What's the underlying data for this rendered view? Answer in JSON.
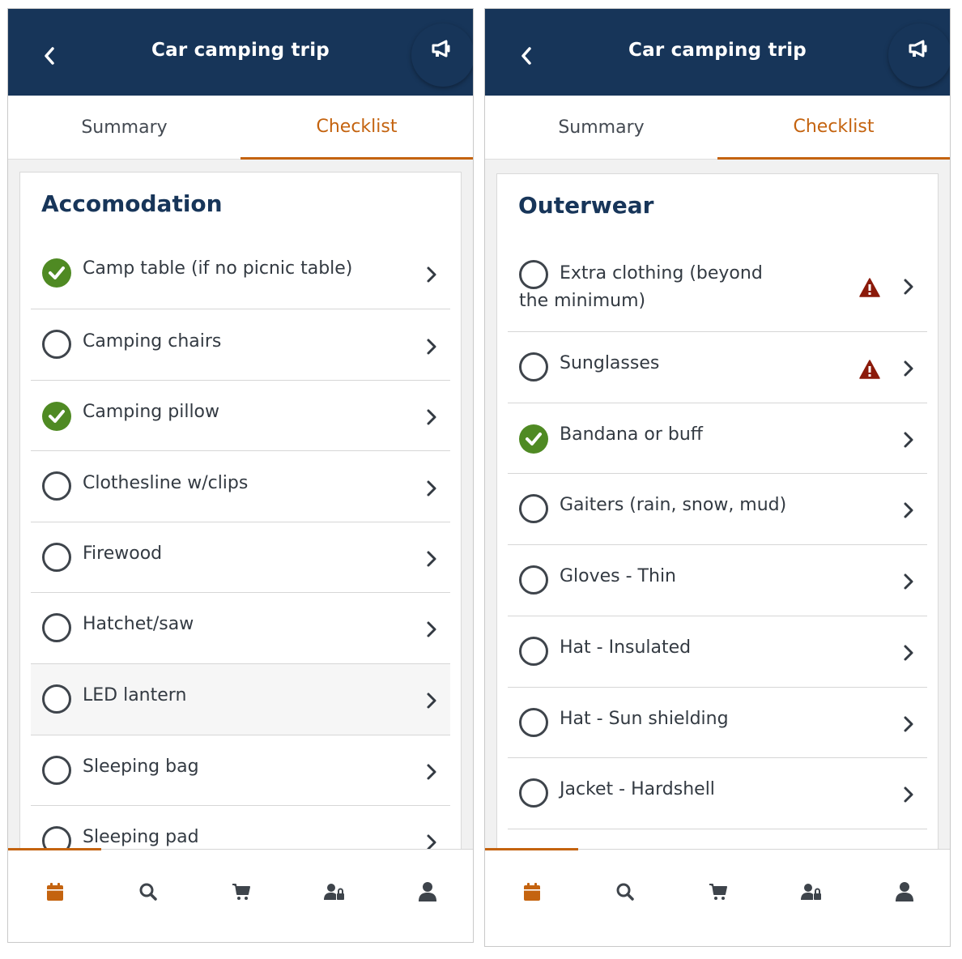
{
  "colors": {
    "header_bg": "#173559",
    "accent": "#c4630f",
    "check_green": "#4f8a23",
    "warning_red": "#8b1a0a",
    "icon_gray": "#3e444b"
  },
  "screens": [
    {
      "header": {
        "title": "Car camping trip",
        "back_icon": "chevron-left-icon",
        "action_icon": "megaphone-icon"
      },
      "tabs": [
        {
          "label": "Summary",
          "active": false
        },
        {
          "label": "Checklist",
          "active": true
        }
      ],
      "section_title": "Accomodation",
      "items": [
        {
          "label": "Camp table (if no picnic table)",
          "checked": true,
          "warning": false
        },
        {
          "label": "Camping chairs",
          "checked": false,
          "warning": false
        },
        {
          "label": "Camping pillow",
          "checked": true,
          "warning": false
        },
        {
          "label": "Clothesline w/clips",
          "checked": false,
          "warning": false
        },
        {
          "label": "Firewood",
          "checked": false,
          "warning": false
        },
        {
          "label": "Hatchet/saw",
          "checked": false,
          "warning": false
        },
        {
          "label": "LED lantern",
          "checked": false,
          "warning": false,
          "highlighted": true
        },
        {
          "label": "Sleeping bag",
          "checked": false,
          "warning": false
        },
        {
          "label": "Sleeping pad",
          "checked": false,
          "warning": false
        }
      ],
      "bottom_nav": [
        {
          "icon": "calendar-icon",
          "active": true
        },
        {
          "icon": "search-icon",
          "active": false
        },
        {
          "icon": "cart-icon",
          "active": false
        },
        {
          "icon": "users-lock-icon",
          "active": false
        },
        {
          "icon": "user-icon",
          "active": false
        }
      ]
    },
    {
      "header": {
        "title": "Car camping trip",
        "back_icon": "chevron-left-icon",
        "action_icon": "megaphone-icon"
      },
      "tabs": [
        {
          "label": "Summary",
          "active": false
        },
        {
          "label": "Checklist",
          "active": true
        }
      ],
      "section_title": "Outerwear",
      "items": [
        {
          "label": "Extra clothing (beyond the minimum)",
          "checked": false,
          "warning": true
        },
        {
          "label": "Sunglasses",
          "checked": false,
          "warning": true
        },
        {
          "label": "Bandana or buff",
          "checked": true,
          "warning": false
        },
        {
          "label": "Gaiters (rain, snow, mud)",
          "checked": false,
          "warning": false
        },
        {
          "label": "Gloves - Thin",
          "checked": false,
          "warning": false
        },
        {
          "label": "Hat - Insulated",
          "checked": false,
          "warning": false
        },
        {
          "label": "Hat - Sun shielding",
          "checked": false,
          "warning": false
        },
        {
          "label": "Jacket - Hardshell",
          "checked": false,
          "warning": false
        }
      ],
      "bottom_nav": [
        {
          "icon": "calendar-icon",
          "active": true
        },
        {
          "icon": "search-icon",
          "active": false
        },
        {
          "icon": "cart-icon",
          "active": false
        },
        {
          "icon": "users-lock-icon",
          "active": false
        },
        {
          "icon": "user-icon",
          "active": false
        }
      ]
    }
  ]
}
